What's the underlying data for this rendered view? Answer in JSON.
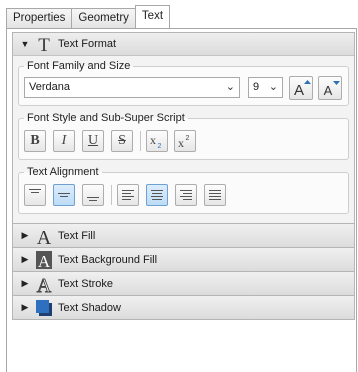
{
  "tabs": [
    {
      "label": "Properties",
      "active": false
    },
    {
      "label": "Geometry",
      "active": false
    },
    {
      "label": "Text",
      "active": true
    }
  ],
  "text_format": {
    "title": "Text Format",
    "expanded": true,
    "icon": "text-format-T-icon",
    "font_group": {
      "legend": "Font Family and Size",
      "family": "Verdana",
      "size": "9",
      "increase_icon": "font-size-increase-icon",
      "decrease_icon": "font-size-decrease-icon"
    },
    "style_group": {
      "legend": "Font Style and Sub-Super Script",
      "bold": "B",
      "italic": "I",
      "underline": "U",
      "strikethrough": "S"
    },
    "align_group": {
      "legend": "Text Alignment",
      "vertical_selected": "middle",
      "horizontal_selected": "center"
    }
  },
  "sections": [
    {
      "label": "Text Fill",
      "icon": "text-fill-icon"
    },
    {
      "label": "Text Background Fill",
      "icon": "text-background-fill-icon"
    },
    {
      "label": "Text Stroke",
      "icon": "text-stroke-icon"
    },
    {
      "label": "Text Shadow",
      "icon": "text-shadow-icon"
    }
  ],
  "colors": {
    "selected_button": "#bcdcf7",
    "shadow_icon": "#2b5fa8"
  }
}
